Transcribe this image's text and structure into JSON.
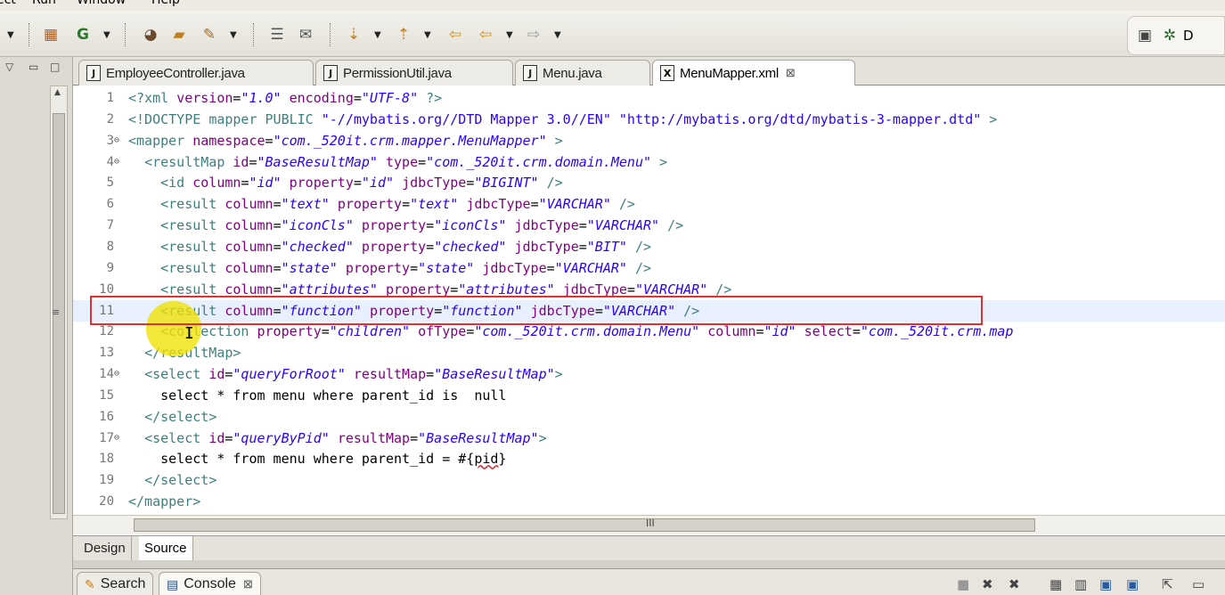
{
  "menu": {
    "items": [
      "ect",
      "Run",
      "Window",
      "Help"
    ]
  },
  "toolbar": {
    "icons": [
      "build-icon",
      "debug-run-icon",
      "open-type-icon",
      "open-folder-icon",
      "rocket-icon",
      "task-icon",
      "mark-icon",
      "next-annotation-icon",
      "prev-annotation-icon",
      "back-icon",
      "forward-icon",
      "last-edit-icon"
    ],
    "perspective_label": "D"
  },
  "tabs": [
    {
      "label": "EmployeeController.java",
      "type": "J"
    },
    {
      "label": "PermissionUtil.java",
      "type": "J"
    },
    {
      "label": "Menu.java",
      "type": "J"
    },
    {
      "label": "MenuMapper.xml",
      "type": "X"
    }
  ],
  "editor": {
    "lines": [
      {
        "num": "1",
        "fold": "",
        "text": "<?xml version=\"1.0\" encoding=\"UTF-8\" ?>"
      },
      {
        "num": "2",
        "fold": "",
        "text": "<!DOCTYPE mapper PUBLIC \"-//mybatis.org//DTD Mapper 3.0//EN\" \"http://mybatis.org/dtd/mybatis-3-mapper.dtd\" >"
      },
      {
        "num": "3",
        "fold": "⊖",
        "text": "<mapper namespace=\"com._520it.crm.mapper.MenuMapper\" >"
      },
      {
        "num": "4",
        "fold": "⊖",
        "text": "  <resultMap id=\"BaseResultMap\" type=\"com._520it.crm.domain.Menu\" >"
      },
      {
        "num": "5",
        "fold": "",
        "text": "    <id column=\"id\" property=\"id\" jdbcType=\"BIGINT\" />"
      },
      {
        "num": "6",
        "fold": "",
        "text": "    <result column=\"text\" property=\"text\" jdbcType=\"VARCHAR\" />"
      },
      {
        "num": "7",
        "fold": "",
        "text": "    <result column=\"iconCls\" property=\"iconCls\" jdbcType=\"VARCHAR\" />"
      },
      {
        "num": "8",
        "fold": "",
        "text": "    <result column=\"checked\" property=\"checked\" jdbcType=\"BIT\" />"
      },
      {
        "num": "9",
        "fold": "",
        "text": "    <result column=\"state\" property=\"state\" jdbcType=\"VARCHAR\" />"
      },
      {
        "num": "10",
        "fold": "",
        "text": "    <result column=\"attributes\" property=\"attributes\" jdbcType=\"VARCHAR\" />"
      },
      {
        "num": "11",
        "fold": "",
        "text": "    <result column=\"function\" property=\"function\" jdbcType=\"VARCHAR\" />"
      },
      {
        "num": "12",
        "fold": "",
        "text": "    <collection property=\"children\" ofType=\"com._520it.crm.domain.Menu\" column=\"id\" select=\"com._520it.crm.map"
      },
      {
        "num": "13",
        "fold": "",
        "text": "  </resultMap>"
      },
      {
        "num": "14",
        "fold": "⊖",
        "text": "  <select id=\"queryForRoot\" resultMap=\"BaseResultMap\">"
      },
      {
        "num": "15",
        "fold": "",
        "text": "    select * from menu where parent_id is  null"
      },
      {
        "num": "16",
        "fold": "",
        "text": "  </select>"
      },
      {
        "num": "17",
        "fold": "⊖",
        "text": "  <select id=\"queryByPid\" resultMap=\"BaseResultMap\">"
      },
      {
        "num": "18",
        "fold": "",
        "text": "    select * from menu where parent_id = #{pid}"
      },
      {
        "num": "19",
        "fold": "",
        "text": "  </select>"
      },
      {
        "num": "20",
        "fold": "",
        "text": "</mapper>"
      }
    ],
    "current_line": "11",
    "hscroll_grip": "III"
  },
  "bottom_tabs": {
    "design": "Design",
    "source": "Source"
  },
  "views": [
    {
      "label": "Search",
      "icon": "search-icon"
    },
    {
      "label": "Console",
      "icon": "console-icon"
    }
  ],
  "colors": {
    "highlight_box": "#e03030",
    "cursor_marker": "#f0e100",
    "xml_tag": "#3f7f7f",
    "xml_attr": "#7f007f",
    "xml_value": "#2a00ff"
  }
}
